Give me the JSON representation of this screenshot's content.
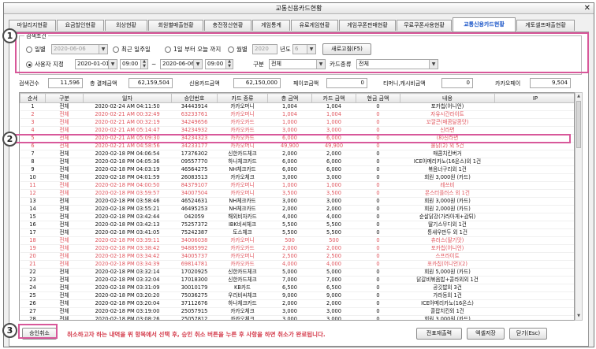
{
  "window": {
    "title": "교통신용카드현황",
    "close_glyph": "✕"
  },
  "tabs": [
    {
      "label": "마일리지현황",
      "active": false
    },
    {
      "label": "요금할인현황",
      "active": false
    },
    {
      "label": "외상현황",
      "active": false
    },
    {
      "label": "회원별매출현황",
      "active": false
    },
    {
      "label": "충전정산현황",
      "active": false
    },
    {
      "label": "게임통계",
      "active": false
    },
    {
      "label": "유료게임현황",
      "active": false
    },
    {
      "label": "게임쿠폰판매현황",
      "active": false
    },
    {
      "label": "무료쿠폰사용현황",
      "active": false
    },
    {
      "label": "교통신용카드현황",
      "active": true
    },
    {
      "label": "게토셀프매출현황",
      "active": false
    }
  ],
  "search": {
    "legend": "검색조건",
    "daily_label": "일별",
    "daily_date": "2020-06-06",
    "recent_week_label": "최근 일주일",
    "one_day_label": "1일 부터 오늘 까지",
    "monthly_label": "월별",
    "year_value": "2020",
    "year_label": "년도",
    "month_value": "6",
    "refresh_button": "새로고침(F5)",
    "custom_label": "사용자 지정",
    "start_date": "2020-01-01",
    "start_time": "09:00",
    "tilde": "~",
    "end_date": "2020-06-06",
    "end_time": "09:00",
    "category_label": "구분",
    "category_value": "전체",
    "card_type_label": "카드종류",
    "card_type_value": "전체"
  },
  "summary": {
    "count_label": "검색건수",
    "count_value": "11,596",
    "total_label": "총 결제금액",
    "total_value": "62,159,504",
    "credit_label": "신용카드금액",
    "credit_value": "62,150,000",
    "payco_label": "페이코금액",
    "payco_value": "0",
    "tmoney_label": "티머니,캐시비금액",
    "tmoney_value": "0",
    "kakaopay_label": "카카오페이",
    "kakaopay_value": "9,504"
  },
  "table": {
    "headers": [
      "순서",
      "구분",
      "일자",
      "승인번호",
      "카드 종류",
      "총 금액",
      "카드 금액",
      "현금 금액",
      "내용",
      "IP"
    ],
    "rows": [
      {
        "cells": [
          "1",
          "전체",
          "2020-02-24 AM 04:11:50",
          "34443914",
          "카카오머니",
          "1,004",
          "1,004",
          "0",
          "포카칩(어니언)",
          ""
        ],
        "status": "normal"
      },
      {
        "cells": [
          "2",
          "전체",
          "2020-02-21 AM 00:32:49",
          "63233761",
          "카카오머니",
          "1,004",
          "1,004",
          "0",
          "자유시간라이트",
          ""
        ],
        "status": "cancel"
      },
      {
        "cells": [
          "3",
          "전체",
          "2020-02-21 AM 00:32:19",
          "34249656",
          "카카오카드",
          "1,000",
          "1,000",
          "0",
          "꼬깔콘(매콤달콤맛)",
          ""
        ],
        "status": "cancel"
      },
      {
        "cells": [
          "4",
          "전체",
          "2020-02-21 AM 05:14:47",
          "34234932",
          "카카오카드",
          "3,000",
          "3,000",
          "0",
          "신라면",
          ""
        ],
        "status": "cancel"
      },
      {
        "cells": [
          "5",
          "전체",
          "2020-02-21 AM 05:09:30",
          "34234323",
          "카카오카드",
          "6,000",
          "6,000",
          "0",
          "(8)신라면",
          ""
        ],
        "status": "cancel"
      },
      {
        "cells": [
          "6",
          "전체",
          "2020-02-21 AM 04:58:56",
          "34233177",
          "카카오머니",
          "49,900",
          "49,900",
          "0",
          "불닭(2) 외 5건",
          ""
        ],
        "status": "selected"
      },
      {
        "cells": [
          "7",
          "전체",
          "2020-02-18 PM 04:06:54",
          "17376302",
          "신한카드체크",
          "2,000",
          "2,000",
          "0",
          "매콤치킨버거",
          ""
        ],
        "status": "normal"
      },
      {
        "cells": [
          "8",
          "전체",
          "2020-02-18 PM 04:05:36",
          "09557770",
          "하나체크카드",
          "6,000",
          "6,000",
          "0",
          "ICE아메리카노(16온스)외 1건",
          ""
        ],
        "status": "normal"
      },
      {
        "cells": [
          "9",
          "전체",
          "2020-02-18 PM 04:03:19",
          "46564275",
          "NH체크카드",
          "6,000",
          "6,000",
          "0",
          "볶음너구리외 1건",
          ""
        ],
        "status": "normal"
      },
      {
        "cells": [
          "10",
          "전체",
          "2020-02-18 PM 04:01:59",
          "26083513",
          "카카오체크",
          "3,000",
          "3,000",
          "0",
          "회원 3,000원 (카드)",
          ""
        ],
        "status": "normal"
      },
      {
        "cells": [
          "11",
          "전체",
          "2020-02-18 PM 04:00:50",
          "84379107",
          "카카오머니",
          "1,000",
          "1,000",
          "0",
          "레쓰비",
          ""
        ],
        "status": "cancel"
      },
      {
        "cells": [
          "12",
          "전체",
          "2020-02-18 PM 03:59:57",
          "34007504",
          "카카오머니",
          "3,500",
          "3,500",
          "0",
          "몬스터플러스 외 1건",
          ""
        ],
        "status": "cancel"
      },
      {
        "cells": [
          "13",
          "전체",
          "2020-02-18 PM 03:58:46",
          "46524631",
          "NH체크카드",
          "3,000",
          "3,000",
          "0",
          "회원 3,000원 (카드)",
          ""
        ],
        "status": "normal"
      },
      {
        "cells": [
          "14",
          "전체",
          "2020-02-18 PM 03:55:21",
          "46495253",
          "NH체크카드",
          "2,000",
          "2,000",
          "0",
          "회원 2,000원 (카드)",
          ""
        ],
        "status": "normal"
      },
      {
        "cells": [
          "15",
          "전체",
          "2020-02-18 PM 03:42:44",
          "042059",
          "해외비자카드",
          "4,000",
          "4,000",
          "0",
          "순살닭강(가라아게+감튀)",
          ""
        ],
        "status": "normal"
      },
      {
        "cells": [
          "16",
          "전체",
          "2020-02-18 PM 03:42:13",
          "75257372",
          "IBK비씨체크",
          "5,500",
          "5,500",
          "0",
          "딸기스무디외 1건",
          ""
        ],
        "status": "normal"
      },
      {
        "cells": [
          "17",
          "전체",
          "2020-02-18 PM 03:41:05",
          "75242387",
          "토스체크",
          "5,500",
          "5,500",
          "0",
          "통새우만두 외 1건",
          ""
        ],
        "status": "normal"
      },
      {
        "cells": [
          "18",
          "전체",
          "2020-02-18 PM 03:39:11",
          "34006038",
          "카카오머니",
          "500",
          "500",
          "0",
          "츄러스(딸기맛)",
          ""
        ],
        "status": "cancel"
      },
      {
        "cells": [
          "19",
          "전체",
          "2020-02-18 PM 03:38:42",
          "94885992",
          "카카오카드",
          "2,000",
          "2,000",
          "0",
          "포카칩(어니언)",
          ""
        ],
        "status": "cancel"
      },
      {
        "cells": [
          "20",
          "전체",
          "2020-02-18 PM 03:34:42",
          "34005737",
          "카카오머니",
          "2,500",
          "2,500",
          "0",
          "스프라이트",
          ""
        ],
        "status": "cancel"
      },
      {
        "cells": [
          "21",
          "전체",
          "2020-02-18 PM 03:34:39",
          "69814781",
          "카카오카드",
          "4,000",
          "4,000",
          "0",
          "포카칩(어니언)(2)",
          ""
        ],
        "status": "cancel"
      },
      {
        "cells": [
          "22",
          "전체",
          "2020-02-18 PM 03:32:14",
          "17020925",
          "신한카드체크",
          "5,000",
          "5,000",
          "0",
          "회원 5,000원 (카드)",
          ""
        ],
        "status": "normal"
      },
      {
        "cells": [
          "23",
          "전체",
          "2020-02-18 PM 03:32:04",
          "17018300",
          "신한카드체크",
          "7,000",
          "7,000",
          "0",
          "닭갈비볶음밥+콜라외외 1건",
          ""
        ],
        "status": "normal"
      },
      {
        "cells": [
          "24",
          "전체",
          "2020-02-18 PM 03:31:09",
          "30010179",
          "KB카드",
          "6,500",
          "6,500",
          "0",
          "공깃밥외 3건",
          ""
        ],
        "status": "normal"
      },
      {
        "cells": [
          "25",
          "전체",
          "2020-02-18 PM 03:20:20",
          "75036275",
          "우리비씨체크",
          "9,000",
          "9,000",
          "0",
          "가라동외 1건",
          ""
        ],
        "status": "normal"
      },
      {
        "cells": [
          "26",
          "전체",
          "2020-02-18 PM 03:20:04",
          "37112676",
          "하나체크카드",
          "2,000",
          "2,000",
          "0",
          "ICE아메리카노(16온스)",
          ""
        ],
        "status": "normal"
      },
      {
        "cells": [
          "27",
          "전체",
          "2020-02-18 PM 03:19:00",
          "25057915",
          "카카오체크",
          "3,000",
          "3,000",
          "0",
          "콜팝치킨외 1건",
          ""
        ],
        "status": "normal"
      },
      {
        "cells": [
          "28",
          "전체",
          "2020-02-18 PM 03:08:26",
          "25057812",
          "카카오체크",
          "3,000",
          "3,000",
          "0",
          "회원 3,000원 (카드)",
          ""
        ],
        "status": "normal"
      },
      {
        "cells": [
          "29",
          "전체",
          "2020-02-18 PM 03:07:55",
          "25057712",
          "카카오체크",
          "2,000",
          "2,000",
          "0",
          "회원 2,000원 (카드)",
          ""
        ],
        "status": "normal"
      },
      {
        "cells": [
          "30",
          "전체",
          "2020-02-18 PM 03:03:56",
          "42054211",
          "카카오머니",
          "2,000",
          "2,000",
          "0",
          "코카콜라",
          ""
        ],
        "status": "normal"
      }
    ]
  },
  "footer": {
    "cancel_button": "승인취소",
    "note": "취소하고자 하는 내역을 위 항목에서 선택 후, 승인 취소 버튼을 누른 후 사항을 하면 취소가 완료됩니다.",
    "reprint_button": "전표재출력",
    "excel_button": "엑셀저장",
    "close_button": "닫기(Esc)"
  },
  "annotations": {
    "badge_1": "1",
    "badge_2": "2",
    "badge_3": "3"
  },
  "colors": {
    "callout": "#d8589a",
    "cancelled_row_text": "#e0555d",
    "active_tab_text": "#1a55c8",
    "footer_note": "#d43b4b"
  }
}
